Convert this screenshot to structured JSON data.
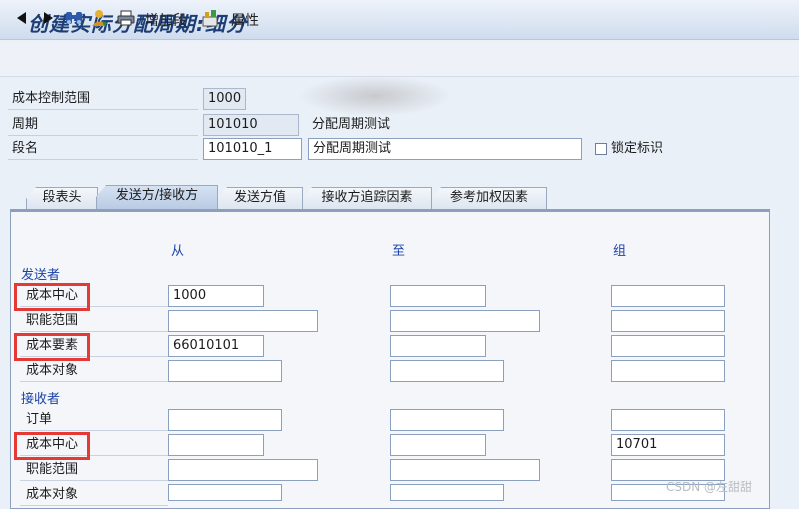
{
  "title": "创建实际分配周期:细分",
  "toolbar": {
    "add_segment": "增加段",
    "attributes": "属性"
  },
  "header": {
    "cost_area_label": "成本控制范围",
    "cost_area_value": "1000",
    "period_label": "周期",
    "period_value": "101010",
    "period_desc": "分配周期测试",
    "segment_label": "段名",
    "segment_value": "101010_1",
    "segment_desc": "分配周期测试",
    "lock_label": "锁定标识"
  },
  "tabs": [
    "段表头",
    "发送方/接收方",
    "发送方值",
    "接收方追踪因素",
    "参考加权因素"
  ],
  "columns": {
    "from": "从",
    "to": "至",
    "group": "组"
  },
  "sender": {
    "heading": "发送者",
    "rows": [
      {
        "label": "成本中心",
        "from": "1000",
        "to": "",
        "group": ""
      },
      {
        "label": "职能范围",
        "from": "",
        "to": "",
        "group": ""
      },
      {
        "label": "成本要素",
        "from": "66010101",
        "to": "",
        "group": ""
      },
      {
        "label": "成本对象",
        "from": "",
        "to": "",
        "group": ""
      }
    ]
  },
  "receiver": {
    "heading": "接收者",
    "rows": [
      {
        "label": "订单",
        "from": "",
        "to": "",
        "group": ""
      },
      {
        "label": "成本中心",
        "from": "",
        "to": "",
        "group": "10701"
      },
      {
        "label": "职能范围",
        "from": "",
        "to": "",
        "group": ""
      },
      {
        "label": "成本对象",
        "from": "",
        "to": "",
        "group": ""
      }
    ]
  },
  "watermark": "CSDN @左甜甜",
  "colors": {
    "accent_blue": "#1d43a8",
    "highlight_red": "#e53935",
    "title_blue": "#1d3e74"
  }
}
